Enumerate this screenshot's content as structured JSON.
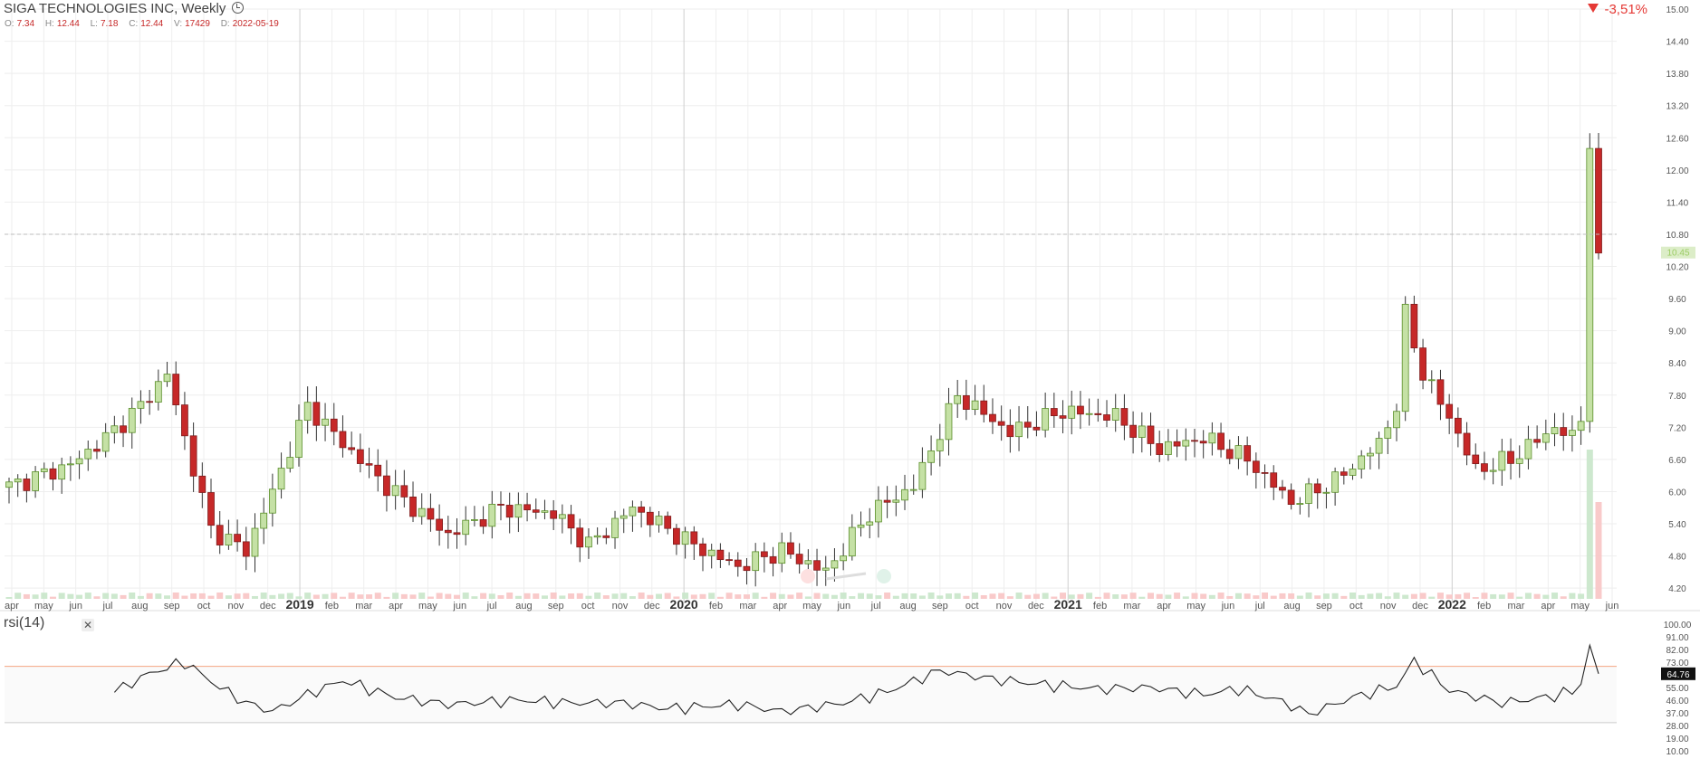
{
  "header": {
    "title": "SIGA TECHNOLOGIES INC, Weekly",
    "ohlc": [
      {
        "k": "O:",
        "v": "7.34"
      },
      {
        "k": "H:",
        "v": "12.44"
      },
      {
        "k": "L:",
        "v": "7.18"
      },
      {
        "k": "C:",
        "v": "12.44"
      },
      {
        "k": "V:",
        "v": "17429"
      },
      {
        "k": "D:",
        "v": "2022-05-19"
      }
    ],
    "change": "-3,51%",
    "change_color": "#e53935"
  },
  "indicator": {
    "label": "rsi(14)",
    "close_icon": "close-icon",
    "last_value_label": "64.76"
  },
  "colors": {
    "up": "#8bc34a",
    "up_fill": "#c5e1a5",
    "down": "#c62828",
    "grid": "#eeeeee",
    "rsi_line": "#222222",
    "rsi_band": "#f4a582"
  },
  "chart_data": [
    {
      "type": "candlestick",
      "title": "SIGA TECHNOLOGIES INC, Weekly",
      "x_ticks": [
        "apr",
        "may",
        "jun",
        "jul",
        "aug",
        "sep",
        "oct",
        "nov",
        "dec",
        "2019",
        "feb",
        "mar",
        "apr",
        "may",
        "jun",
        "jul",
        "aug",
        "sep",
        "oct",
        "nov",
        "dec",
        "2020",
        "feb",
        "mar",
        "apr",
        "may",
        "jun",
        "jul",
        "aug",
        "sep",
        "oct",
        "nov",
        "dec",
        "2021",
        "feb",
        "mar",
        "apr",
        "may",
        "jun",
        "jul",
        "aug",
        "sep",
        "oct",
        "nov",
        "dec",
        "2022",
        "feb",
        "mar",
        "apr",
        "may",
        "jun"
      ],
      "y_ticks": [
        "4.20",
        "4.80",
        "5.40",
        "6.00",
        "6.60",
        "7.20",
        "7.80",
        "8.40",
        "9.00",
        "9.60",
        "10.20",
        "10.80",
        "11.40",
        "12.00",
        "12.60",
        "13.20",
        "13.80",
        "14.40",
        "15.00"
      ],
      "ylim": [
        4.0,
        15.0
      ],
      "price_line": 10.8,
      "price_tag": "10.45",
      "anchors": [
        [
          0,
          6.1
        ],
        [
          7,
          6.5
        ],
        [
          11,
          7.0
        ],
        [
          15,
          7.6
        ],
        [
          18,
          8.2
        ],
        [
          20,
          7.0
        ],
        [
          23,
          5.3
        ],
        [
          27,
          4.9
        ],
        [
          30,
          6.0
        ],
        [
          34,
          7.6
        ],
        [
          38,
          6.9
        ],
        [
          43,
          6.1
        ],
        [
          50,
          5.2
        ],
        [
          56,
          5.7
        ],
        [
          62,
          5.6
        ],
        [
          66,
          5.0
        ],
        [
          71,
          5.7
        ],
        [
          78,
          5.0
        ],
        [
          83,
          4.6
        ],
        [
          88,
          4.9
        ],
        [
          93,
          4.5
        ],
        [
          98,
          5.6
        ],
        [
          103,
          6.1
        ],
        [
          108,
          7.8
        ],
        [
          114,
          7.1
        ],
        [
          120,
          7.5
        ],
        [
          126,
          7.4
        ],
        [
          131,
          6.8
        ],
        [
          136,
          7.0
        ],
        [
          141,
          6.6
        ],
        [
          146,
          5.8
        ],
        [
          151,
          6.2
        ],
        [
          156,
          6.9
        ],
        [
          158,
          7.6
        ],
        [
          159,
          9.3
        ],
        [
          161,
          8.2
        ],
        [
          164,
          7.4
        ],
        [
          167,
          6.4
        ],
        [
          171,
          6.6
        ],
        [
          176,
          7.2
        ],
        [
          178,
          7.0
        ],
        [
          179,
          7.4
        ],
        [
          180,
          12.4
        ],
        [
          181,
          10.45
        ]
      ],
      "volume_note": "shown as small bars along bottom; last two weeks much larger"
    },
    {
      "type": "line",
      "name": "rsi(14)",
      "y_ticks": [
        "100.00",
        "91.00",
        "82.00",
        "73.00",
        "64.00",
        "55.00",
        "46.00",
        "37.00",
        "28.00",
        "19.00",
        "10.00"
      ],
      "ylim": [
        10,
        100
      ],
      "upper_band": 70,
      "lower_band": 30,
      "last_value": 64.76,
      "anchors": [
        [
          12,
          52
        ],
        [
          16,
          65
        ],
        [
          20,
          73
        ],
        [
          24,
          55
        ],
        [
          27,
          44
        ],
        [
          30,
          38
        ],
        [
          34,
          50
        ],
        [
          38,
          60
        ],
        [
          44,
          48
        ],
        [
          50,
          43
        ],
        [
          58,
          46
        ],
        [
          64,
          44
        ],
        [
          70,
          44
        ],
        [
          75,
          40
        ],
        [
          83,
          43
        ],
        [
          88,
          38
        ],
        [
          95,
          44
        ],
        [
          100,
          52
        ],
        [
          106,
          67
        ],
        [
          112,
          61
        ],
        [
          118,
          57
        ],
        [
          124,
          54
        ],
        [
          130,
          55
        ],
        [
          136,
          50
        ],
        [
          140,
          54
        ],
        [
          145,
          45
        ],
        [
          148,
          36
        ],
        [
          153,
          48
        ],
        [
          158,
          56
        ],
        [
          160,
          74
        ],
        [
          164,
          53
        ],
        [
          170,
          44
        ],
        [
          175,
          48
        ],
        [
          178,
          52
        ],
        [
          179,
          58
        ],
        [
          180,
          85
        ],
        [
          181,
          64.76
        ]
      ]
    }
  ]
}
